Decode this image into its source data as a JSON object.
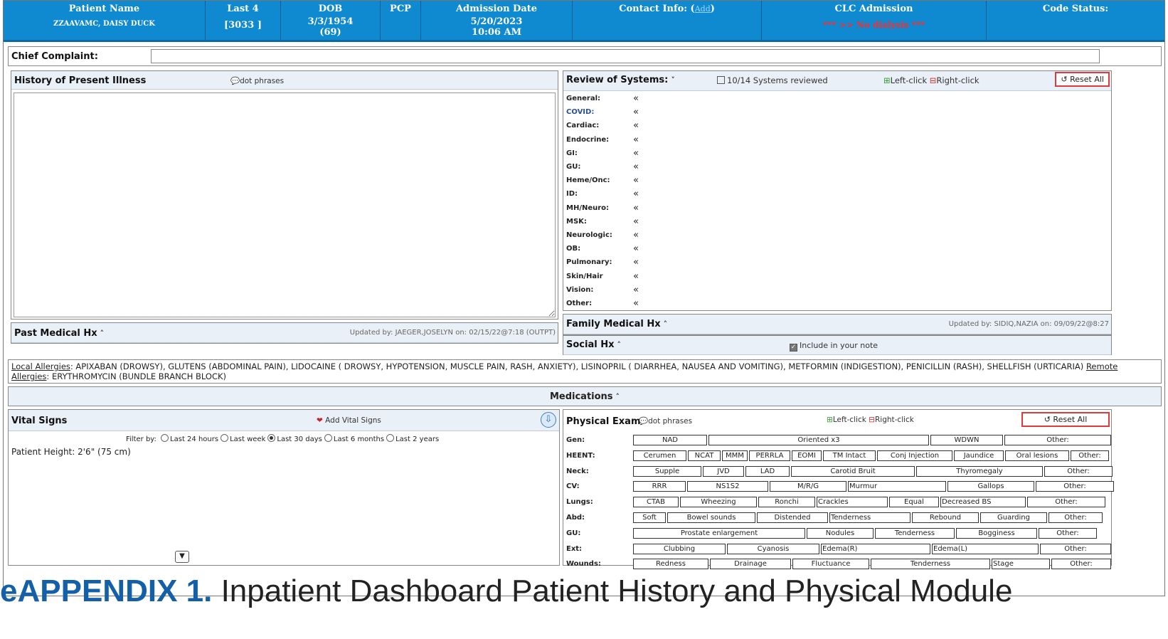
{
  "header": {
    "patient_name_label": "Patient Name",
    "patient_name": "ZZAAVAMC, DAISY DUCK",
    "last4_label": "Last 4",
    "last4": "[3033 ]",
    "dob_label": "DOB",
    "dob": "3/3/1954",
    "age": "(69)",
    "pcp_label": "PCP",
    "admission_label": "Admission Date",
    "admission_date": "5/20/2023",
    "admission_time": "10:06 AM",
    "contact_label": "Contact Info: (",
    "contact_link": "Add",
    "contact_close": ")",
    "clc_label": "CLC Admission",
    "clc_alert": "*** >> No dialysis ***",
    "code_status_label": "Code Status:"
  },
  "chief_complaint": {
    "label": "Chief Complaint:",
    "value": ""
  },
  "hpi": {
    "title": "History of Present Illness",
    "dot_phrases": "dot phrases",
    "text": ""
  },
  "past_medical": {
    "title": "Past Medical Hx",
    "updated": "Updated by: JAEGER,JOSELYN on: 02/15/22@7:18 (OUTPT)"
  },
  "ros": {
    "title": "Review of Systems:",
    "systems_reviewed": "10/14 Systems reviewed",
    "left_click": "Left-click",
    "right_click": "Right-click",
    "reset": "Reset All",
    "items": [
      {
        "label": "General:"
      },
      {
        "label": "COVID:"
      },
      {
        "label": "Cardiac:"
      },
      {
        "label": "Endocrine:"
      },
      {
        "label": "GI:"
      },
      {
        "label": "GU:"
      },
      {
        "label": "Heme/Onc:"
      },
      {
        "label": "ID:"
      },
      {
        "label": "MH/Neuro:"
      },
      {
        "label": "MSK:"
      },
      {
        "label": "Neurologic:"
      },
      {
        "label": "OB:"
      },
      {
        "label": "Pulmonary:"
      },
      {
        "label": "Skin/Hair"
      },
      {
        "label": "Vision:"
      },
      {
        "label": "Other:"
      }
    ],
    "covid_color": "#2a4f9e"
  },
  "family_medical": {
    "title": "Family Medical Hx",
    "updated": "Updated by: SIDIQ,NAZIA on: 09/09/22@8:27"
  },
  "social": {
    "title": "Social Hx",
    "include_label": "Include in your note"
  },
  "allergies": {
    "local_label": "Local Allergies",
    "local_text": ": APIXABAN (DROWSY), GLUTENS (ABDOMINAL PAIN), LIDOCAINE ( DROWSY, HYPOTENSION, MUSCLE PAIN, RASH, ANXIETY), LISINOPRIL ( DIARRHEA, NAUSEA AND VOMITING), METFORMIN (INDIGESTION), PENICILLIN (RASH), SHELLFISH (URTICARIA) ",
    "remote_label": "Remote Allergies",
    "remote_text": ": ERYTHROMYCIN (BUNDLE BRANCH BLOCK)"
  },
  "medications": {
    "title": "Medications"
  },
  "vitals": {
    "title": "Vital Signs",
    "add_label": "Add Vital Signs",
    "filter_label": "Filter by:",
    "filters": [
      "Last 24 hours",
      "Last week",
      "Last 30 days",
      "Last 6 months",
      "Last 2 years"
    ],
    "selected_filter": "Last 30 days",
    "height": "Patient Height: 2'6\" (75 cm)"
  },
  "physical_exam": {
    "title": "Physical Exam",
    "dot_phrases": "dot phrases",
    "left_click": "Left-click",
    "right_click": "Right-click",
    "reset": "Reset All",
    "rows": [
      {
        "label": "Gen:",
        "cells": [
          "NAD",
          "Oriented x3",
          "WDWN",
          "Other:"
        ]
      },
      {
        "label": "HEENT:",
        "cells": [
          "Cerumen",
          "NCAT",
          "MMM",
          "PERRLA",
          "EOMI",
          "TM Intact",
          "Conj Injection",
          "Jaundice",
          "Oral lesions",
          "Other:"
        ]
      },
      {
        "label": "Neck:",
        "cells": [
          "Supple",
          "JVD",
          "LAD",
          "Carotid Bruit",
          "Thyromegaly",
          "Other:"
        ]
      },
      {
        "label": "CV:",
        "cells": [
          "RRR",
          "NS1S2",
          "M/R/G",
          "Murmur",
          "Gallops",
          "Other:"
        ]
      },
      {
        "label": "Lungs:",
        "cells": [
          "CTAB",
          "Wheezing",
          "Ronchi",
          "Crackles",
          "Equal",
          "Decreased BS",
          "Other:"
        ]
      },
      {
        "label": "Abd:",
        "cells": [
          "Soft",
          "Bowel sounds",
          "Distended",
          "Tenderness",
          "Rebound",
          "Guarding",
          "Other:"
        ]
      },
      {
        "label": "GU:",
        "cells": [
          "Prostate enlargement",
          "Nodules",
          "Tenderness",
          "Bogginess",
          "Other:"
        ]
      },
      {
        "label": "Ext:",
        "cells": [
          "Clubbing",
          "Cyanosis",
          "Edema(R)",
          "Edema(L)",
          "Other:"
        ]
      },
      {
        "label": "Wounds:",
        "cells": [
          "Redness",
          "Drainage",
          "Fluctuance",
          "Tenderness",
          "Stage",
          "Other:"
        ]
      }
    ]
  },
  "caption": {
    "label": "eAPPENDIX 1.",
    "text": " Inpatient Dashboard Patient History and Physical Module"
  },
  "colors": {
    "header_bg": "#0f8ad0",
    "alert": "#ff2a2a",
    "reset_border": "#e23a3a",
    "caption_label": "#1460a8"
  }
}
